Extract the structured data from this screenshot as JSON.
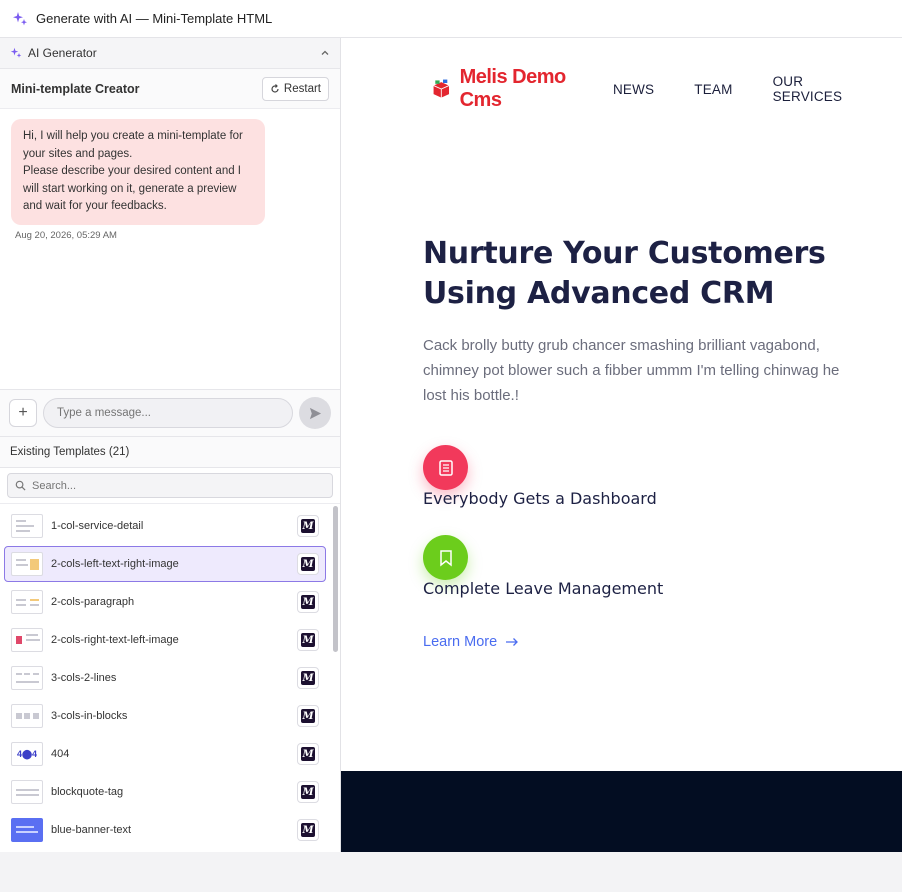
{
  "window": {
    "title": "Generate with AI — Mini-Template HTML"
  },
  "generator": {
    "header": "AI Generator",
    "creator_title": "Mini-template Creator",
    "restart_label": "Restart",
    "message": "Hi, I will help you create a mini-template for your sites and pages.\nPlease describe your desired content and I will start working on it, generate a preview and wait for your feedbacks.",
    "timestamp": "Aug 20, 2026, 05:29 AM",
    "input_placeholder": "Type a message..."
  },
  "templates": {
    "heading": "Existing Templates (21)",
    "search_placeholder": "Search...",
    "items": [
      {
        "name": "1-col-service-detail"
      },
      {
        "name": "2-cols-left-text-right-image",
        "selected": true
      },
      {
        "name": "2-cols-paragraph"
      },
      {
        "name": "2-cols-right-text-left-image"
      },
      {
        "name": "3-cols-2-lines"
      },
      {
        "name": "3-cols-in-blocks"
      },
      {
        "name": "404",
        "thumb_text": "4⬤4"
      },
      {
        "name": "blockquote-tag"
      },
      {
        "name": "blue-banner-text"
      }
    ]
  },
  "preview": {
    "logo_text": "Melis Demo Cms",
    "nav": [
      "NEWS",
      "TEAM",
      "OUR SERVICES"
    ],
    "hero_title": "Nurture Your Customers Using Advanced CRM",
    "hero_text": "Cack brolly butty grub chancer smashing brilliant vagabond, chimney pot blower such a fibber ummm I'm telling chinwag he lost his bottle.!",
    "features": [
      {
        "label": "Everybody Gets a Dashboard",
        "color": "#f2395b",
        "icon": "document-icon"
      },
      {
        "label": "Complete Leave Management",
        "color": "#6ccd1c",
        "icon": "bookmark-icon"
      }
    ],
    "learn_more": "Learn More",
    "colors": {
      "accent": "#4a6cf0",
      "title": "#1d2144",
      "dark_band": "#030d22",
      "logo": "#e3262f"
    }
  }
}
